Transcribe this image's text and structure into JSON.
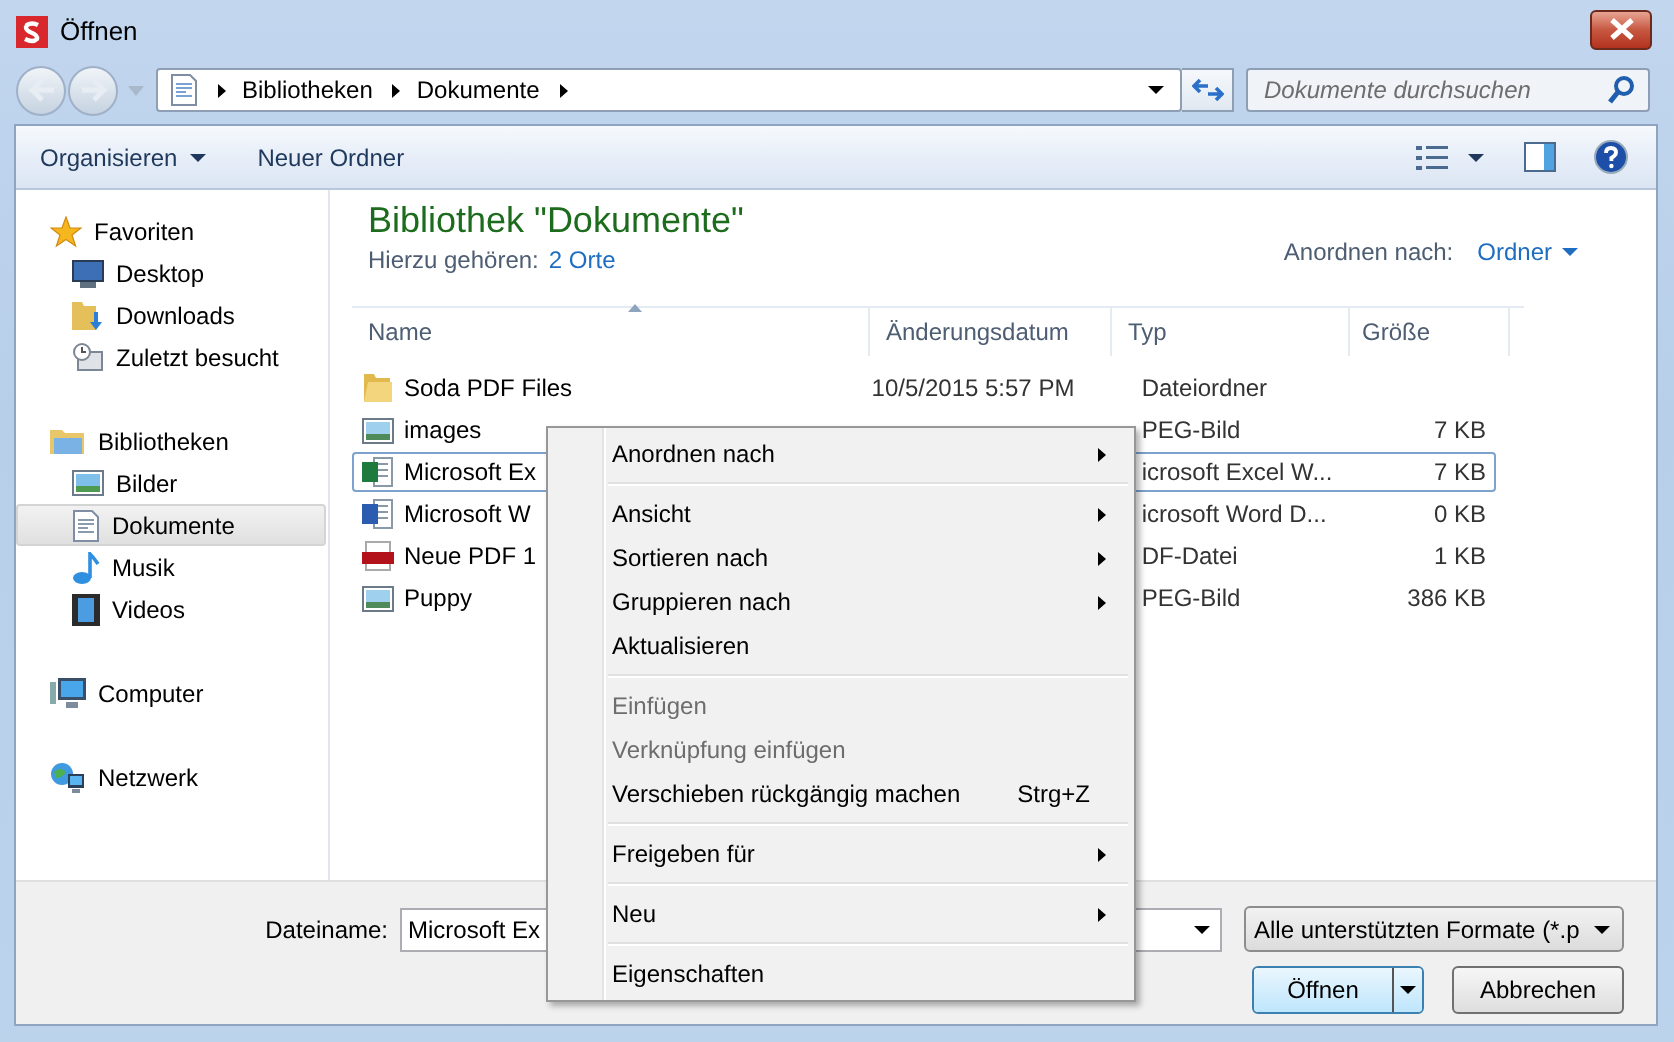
{
  "window": {
    "title": "Öffnen"
  },
  "address": {
    "crumbs": [
      "Bibliotheken",
      "Dokumente"
    ]
  },
  "search": {
    "placeholder": "Dokumente durchsuchen"
  },
  "toolbar": {
    "organize": "Organisieren",
    "new_folder": "Neuer Ordner"
  },
  "sidebar": {
    "groups": [
      {
        "label": "Favoriten",
        "children": [
          {
            "label": "Desktop",
            "selected": false
          },
          {
            "label": "Downloads",
            "selected": false
          },
          {
            "label": "Zuletzt besucht",
            "selected": false
          }
        ]
      },
      {
        "label": "Bibliotheken",
        "children": [
          {
            "label": "Bilder",
            "selected": false
          },
          {
            "label": "Dokumente",
            "selected": true
          },
          {
            "label": "Musik",
            "selected": false
          },
          {
            "label": "Videos",
            "selected": false
          }
        ]
      },
      {
        "label": "Computer"
      },
      {
        "label": "Netzwerk"
      }
    ]
  },
  "library": {
    "title": "Bibliothek \"Dokumente\"",
    "includes_label": "Hierzu gehören:",
    "includes_link": "2 Orte",
    "arrange_label": "Anordnen nach:",
    "arrange_value": "Ordner"
  },
  "table": {
    "columns": [
      "Name",
      "Änderungsdatum",
      "Typ",
      "Größe"
    ],
    "rows": [
      {
        "kind": "folder",
        "name": "Soda PDF Files",
        "date": "10/5/2015 5:57 PM",
        "type": "Dateiordner",
        "selected": false
      },
      {
        "kind": "image",
        "name": "images",
        "type": "PEG-Bild",
        "size": "7 KB",
        "selected": false
      },
      {
        "kind": "excel",
        "name": "Microsoft Ex",
        "type": "icrosoft Excel W...",
        "size": "7 KB",
        "selected": true
      },
      {
        "kind": "word",
        "name": "Microsoft W",
        "type": "icrosoft Word D...",
        "size": "0 KB",
        "selected": false
      },
      {
        "kind": "pdf",
        "name": "Neue PDF 1",
        "type": "DF-Datei",
        "size": "1 KB",
        "selected": false
      },
      {
        "kind": "image",
        "name": "Puppy",
        "type": "PEG-Bild",
        "size": "386 KB",
        "selected": false
      }
    ]
  },
  "context_menu": [
    {
      "kind": "item",
      "label": "Anordnen nach",
      "submenu": true,
      "disabled": false
    },
    {
      "kind": "separator"
    },
    {
      "kind": "item",
      "label": "Ansicht",
      "submenu": true,
      "disabled": false
    },
    {
      "kind": "item",
      "label": "Sortieren nach",
      "submenu": true,
      "disabled": false
    },
    {
      "kind": "item",
      "label": "Gruppieren nach",
      "submenu": true,
      "disabled": false
    },
    {
      "kind": "item",
      "label": "Aktualisieren",
      "submenu": false,
      "disabled": false
    },
    {
      "kind": "separator"
    },
    {
      "kind": "item",
      "label": "Einfügen",
      "submenu": false,
      "disabled": true
    },
    {
      "kind": "item",
      "label": "Verknüpfung einfügen",
      "submenu": false,
      "disabled": true
    },
    {
      "kind": "item",
      "label": "Verschieben rückgängig machen",
      "shortcut": "Strg+Z",
      "submenu": false,
      "disabled": false
    },
    {
      "kind": "separator"
    },
    {
      "kind": "item",
      "label": "Freigeben für",
      "submenu": true,
      "disabled": false
    },
    {
      "kind": "separator"
    },
    {
      "kind": "item",
      "label": "Neu",
      "submenu": true,
      "disabled": false
    },
    {
      "kind": "separator"
    },
    {
      "kind": "item",
      "label": "Eigenschaften",
      "submenu": false,
      "disabled": false
    }
  ],
  "footer": {
    "filename_label": "Dateiname:",
    "filename_value": "Microsoft Ex",
    "filter": "Alle unterstützten Formate (*.p",
    "open": "Öffnen",
    "cancel": "Abbrechen"
  }
}
